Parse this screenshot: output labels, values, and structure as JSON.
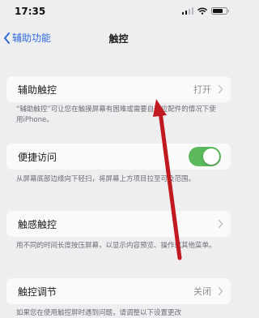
{
  "status_bar": {
    "time": "17:35"
  },
  "nav": {
    "back_label": "辅助功能",
    "title": "触控"
  },
  "rows": [
    {
      "label": "辅助触控",
      "value": "打开",
      "footer": "“辅助触控”可让您在触摸屏幕有困难或需要自适应配件的情况下使用iPhone。"
    },
    {
      "label": "便捷访问",
      "toggle_on": true,
      "footer": "从屏幕底部边缘向下轻扫，将屏幕上方项目拉至可及范围。"
    },
    {
      "label": "触感触控",
      "footer": "用不同的时间长度按压屏幕，以显示内容预览、操作或其他菜单。"
    },
    {
      "label": "触控调节",
      "value": "关闭",
      "footer": "如果您在使用触控屏时遇到问题，请调整以下设置更改"
    }
  ],
  "colors": {
    "accent": "#2f6bd8",
    "toggle_on": "#5bb85b",
    "annotation_arrow": "#c0191f"
  }
}
